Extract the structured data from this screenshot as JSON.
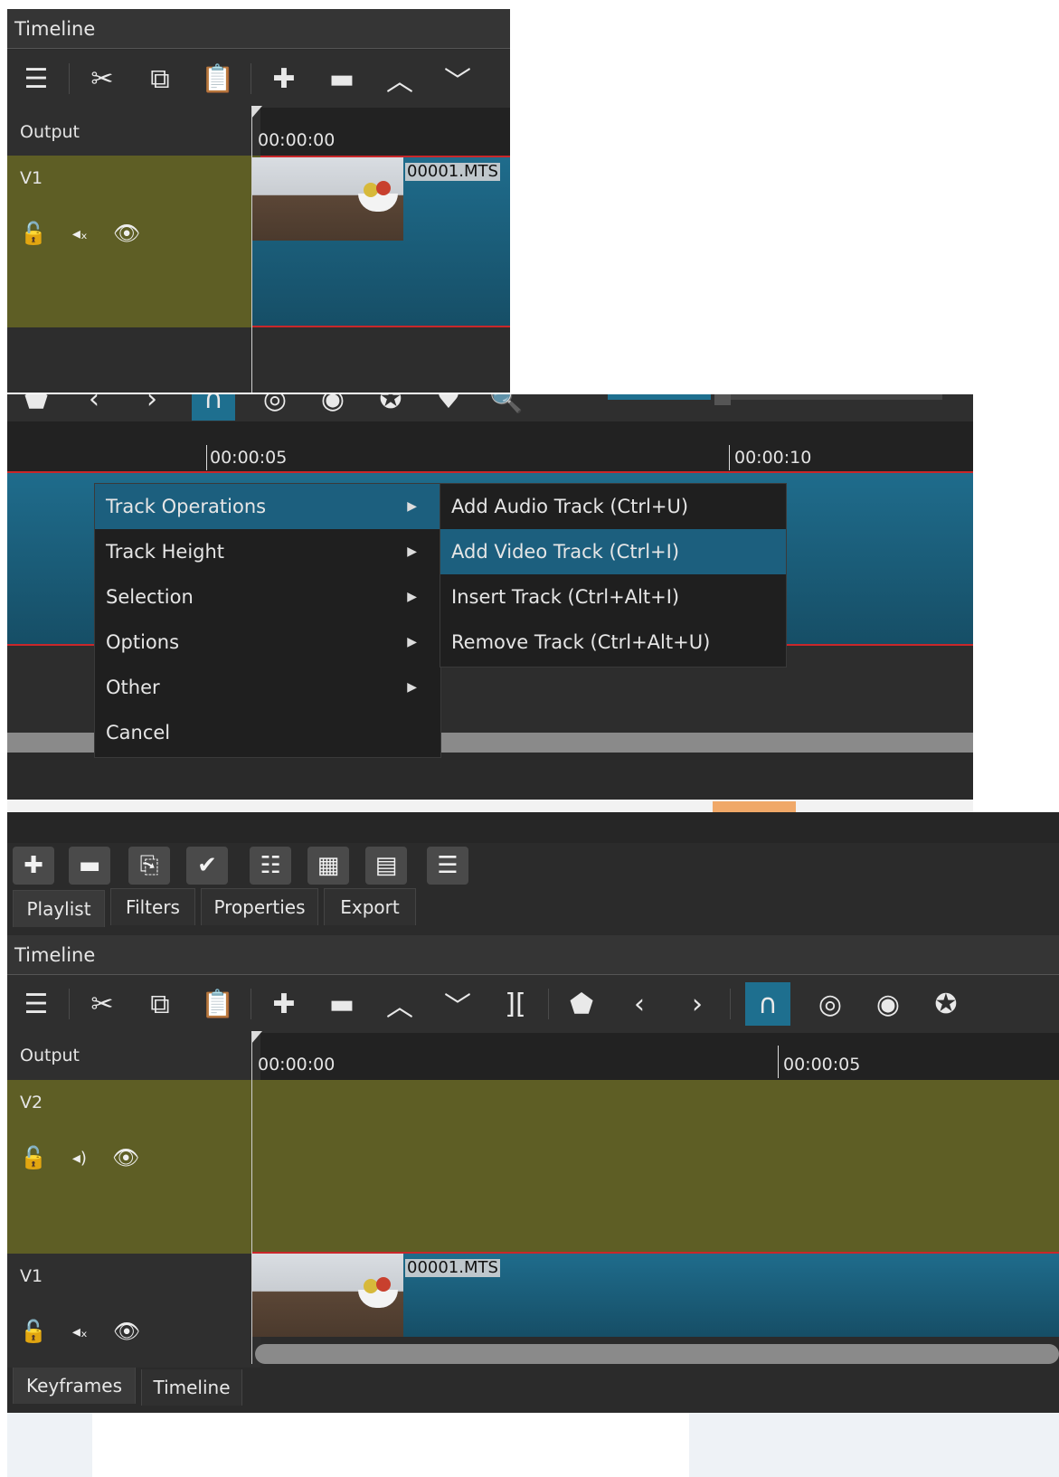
{
  "panel1": {
    "title": "Timeline",
    "output_label": "Output",
    "timecode_start": "00:00:00",
    "track": {
      "name": "V1"
    },
    "clip_name": "00001.MTS"
  },
  "panel2": {
    "timecode_a": "00:00:05",
    "timecode_b": "00:00:10",
    "menu": {
      "items": [
        "Track Operations",
        "Track Height",
        "Selection",
        "Options",
        "Other",
        "Cancel"
      ],
      "submenu": [
        "Add Audio Track (Ctrl+U)",
        "Add Video Track (Ctrl+I)",
        "Insert Track (Ctrl+Alt+I)",
        "Remove Track (Ctrl+Alt+U)"
      ]
    }
  },
  "panel3": {
    "tabs": [
      "Playlist",
      "Filters",
      "Properties",
      "Export"
    ],
    "title": "Timeline",
    "output_label": "Output",
    "timecode_start": "00:00:00",
    "timecode_mid": "00:00:05",
    "tracks": [
      "V2",
      "V1"
    ],
    "clip_name": "00001.MTS",
    "bottom_tabs": [
      "Keyframes",
      "Timeline"
    ]
  },
  "colors": {
    "track_olive": "#5e5e25",
    "clip_blue": "#1f6c8c",
    "highlight": "#1c5f7e",
    "playhead_red": "#c9272a",
    "snap_active": "#1e6f8f"
  },
  "icons": [
    "menu-icon",
    "cut-icon",
    "copy-icon",
    "paste-icon",
    "append-icon",
    "remove-icon",
    "lift-icon",
    "overwrite-icon",
    "split-icon",
    "marker-icon",
    "prev-icon",
    "next-icon",
    "snap-icon",
    "scrub-icon",
    "ripple-icon",
    "ripple-all-icon",
    "lock-icon",
    "mute-icon",
    "eye-icon"
  ]
}
